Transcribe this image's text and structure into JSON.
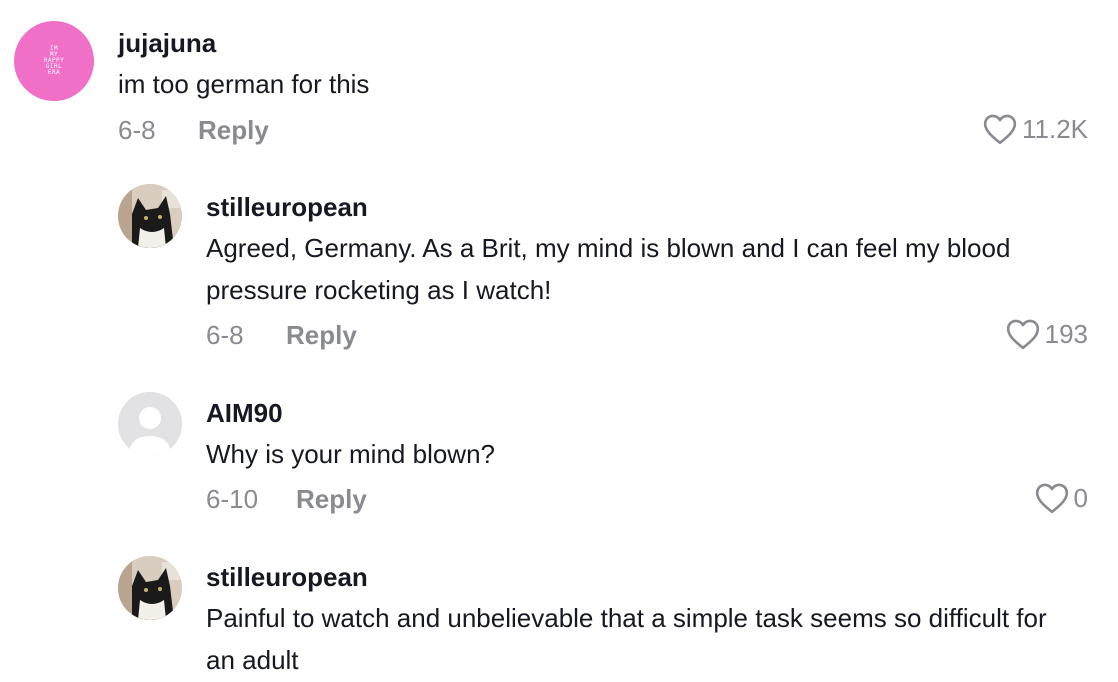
{
  "comments": [
    {
      "username": "jujajuna",
      "text": "im too german for this",
      "date": "6-8",
      "reply_label": "Reply",
      "likes": "11.2K",
      "avatar": {
        "type": "pink-text",
        "lines": [
          "IM",
          "MY",
          "HAPPY",
          "GIRL",
          "ERA"
        ],
        "color": "#f06fc7"
      }
    },
    {
      "username": "stilleuropean",
      "text": "Agreed, Germany. As a Brit, my mind is blown and I can feel my blood pressure rocketing as I watch!",
      "date": "6-8",
      "reply_label": "Reply",
      "likes": "193",
      "avatar": {
        "type": "cat-photo"
      }
    },
    {
      "username": "AIM90",
      "text": "Why is your mind blown?",
      "date": "6-10",
      "reply_label": "Reply",
      "likes": "0",
      "avatar": {
        "type": "default-user"
      }
    },
    {
      "username": "stilleuropean",
      "text": "Painful to watch and unbelievable that a simple task seems so difficult for an adult",
      "avatar": {
        "type": "cat-photo"
      }
    }
  ],
  "colors": {
    "text": "#161823",
    "muted": "#8a8b91",
    "accent_avatar": "#f06fc7"
  },
  "icons": {
    "like": "heart-outline-icon"
  }
}
